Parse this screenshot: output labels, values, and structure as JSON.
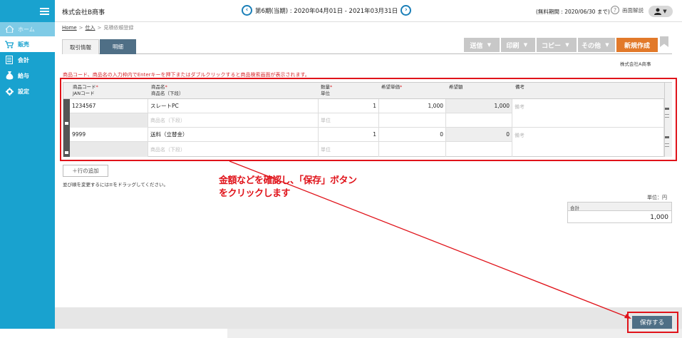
{
  "sidebar": {
    "items": [
      {
        "label": "ホーム",
        "icon": "home-icon"
      },
      {
        "label": "販売",
        "icon": "cart-icon"
      },
      {
        "label": "会計",
        "icon": "ledger-icon"
      },
      {
        "label": "給与",
        "icon": "money-bag-icon"
      },
      {
        "label": "設定",
        "icon": "gear-icon"
      }
    ]
  },
  "header": {
    "company": "株式会社B商事",
    "period": "第6期(当期) : 2020年04月01日 - 2021年03月31日",
    "trial": "(無料期間 : 2020/06/30 まで)",
    "help": "画面解説",
    "prev_icon": "‹",
    "next_icon": "›",
    "user_icon": "▼"
  },
  "breadcrumb": {
    "items": [
      "Home",
      "仕入",
      "見積依頼登録"
    ],
    "sep": ">"
  },
  "tabs": [
    "取引情報",
    "明細"
  ],
  "toolbar": {
    "send": "送信",
    "print": "印刷",
    "copy": "コピー",
    "other": "その他",
    "new": "新規作成"
  },
  "counterparty": "株式会社A商事",
  "note": "商品コード、商品名の入力枠内でEnterキーを押下またはダブルクリックすると商品検索画面が表示されます。",
  "table": {
    "headers": {
      "code": "商品コード",
      "jan": "JANコード",
      "name": "商品名",
      "name_sub": "商品名（下段）",
      "qty": "数量",
      "unit": "単位",
      "price": "希望単価",
      "amount": "希望額",
      "remarks": "備考",
      "required_mark": "*"
    },
    "rows": [
      {
        "code": "1234567",
        "name": "スレートPC",
        "qty": "1",
        "price": "1,000",
        "amount": "1,000",
        "remarks_ph": "備考",
        "name_sub_ph": "商品名（下段）",
        "unit_ph": "単位"
      },
      {
        "code": "9999",
        "name": "送料（立替金）",
        "qty": "1",
        "price": "0",
        "amount": "0",
        "remarks_ph": "備考",
        "name_sub_ph": "商品名（下段）",
        "unit_ph": "単位"
      }
    ]
  },
  "add_row": "＋行の追加",
  "drag_note": "並び順を変更するには≡をドラッグしてください。",
  "callout": {
    "line1": "金額などを確認し、「保存」ボタン",
    "line2": "をクリックします"
  },
  "summary": {
    "unit": "単位：円",
    "total_label": "合計",
    "total_value": "1,000"
  },
  "footer": {
    "save": "保存する"
  },
  "colors": {
    "sidebar": "#19a2cf",
    "accent": "#e2792a",
    "primary_button": "#4f6f86",
    "annotation": "#e0131a"
  }
}
